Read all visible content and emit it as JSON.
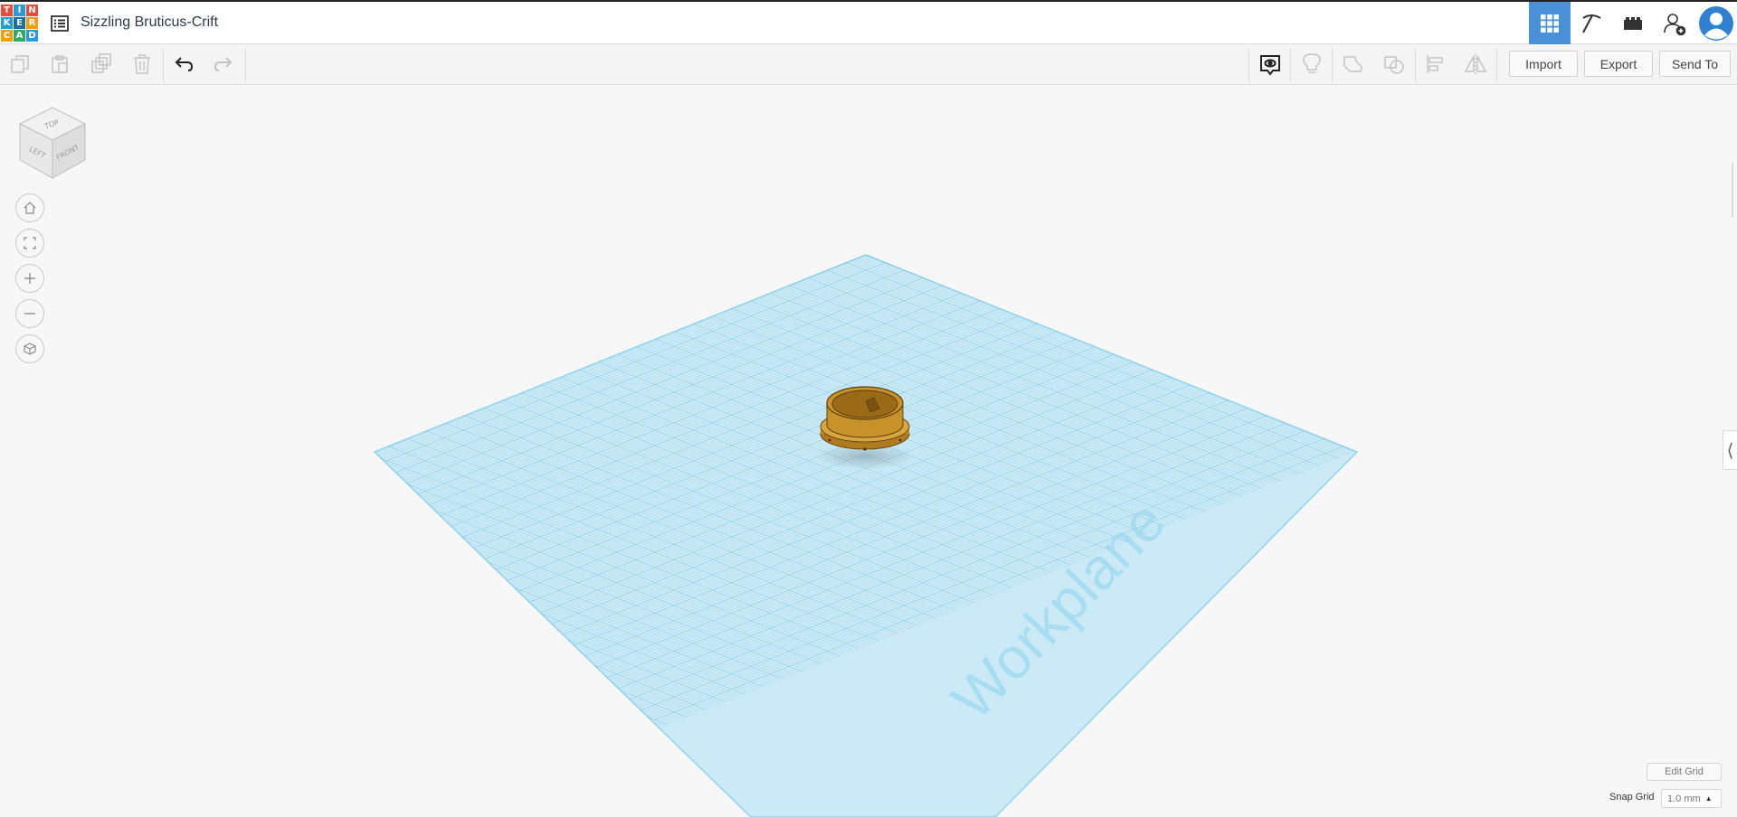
{
  "logo": {
    "letters": [
      "T",
      "I",
      "N",
      "K",
      "E",
      "R",
      "C",
      "A",
      "D"
    ],
    "colors": [
      "#e74c3c",
      "#2b9bd6",
      "#e74c3c",
      "#2b9bd6",
      "#1e6f9c",
      "#f39c12",
      "#f39c12",
      "#27ae60",
      "#2b9bd6"
    ]
  },
  "header": {
    "doc_list_icon": "list-icon",
    "title": "Sizzling Bruticus-Crift",
    "buttons": [
      "3d-design-grid-icon",
      "pickaxe-icon",
      "bricks-icon",
      "add-user-icon",
      "avatar"
    ]
  },
  "toolbar": {
    "left_tools": [
      "copy-icon",
      "paste-icon",
      "duplicate-icon",
      "delete-icon",
      "undo-icon",
      "redo-icon"
    ],
    "right_tools": [
      "show-notes-icon",
      "light-bulb-icon",
      "group-icon",
      "ungroup-icon",
      "align-icon",
      "mirror-icon"
    ],
    "import_label": "Import",
    "export_label": "Export",
    "send_to_label": "Send To"
  },
  "viewcube": {
    "top": "TOP",
    "left": "LEFT",
    "front": "FRONT"
  },
  "nav": [
    "home-view-icon",
    "fit-view-icon",
    "zoom-in-icon",
    "zoom-out-icon",
    "perspective-icon"
  ],
  "workplane": {
    "label": "Workplane",
    "accent": "#8fd3ec",
    "object_color": "#c8922a"
  },
  "right_panel_toggle": "⟨",
  "footer": {
    "edit_grid": "Edit Grid",
    "snap_label": "Snap Grid",
    "snap_value": "1.0 mm"
  }
}
